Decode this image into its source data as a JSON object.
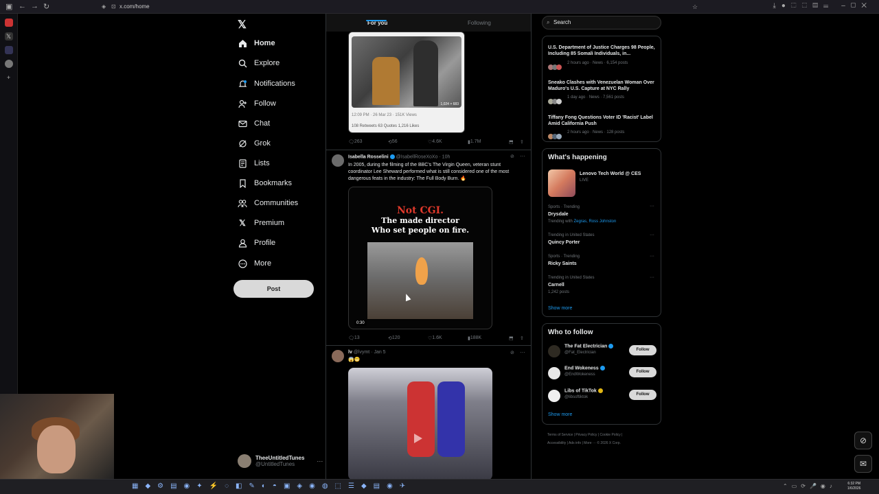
{
  "browser": {
    "url": "x.com/home"
  },
  "logo": "𝕏",
  "nav": [
    {
      "label": "Home",
      "icon": "home-icon"
    },
    {
      "label": "Explore",
      "icon": "search-icon"
    },
    {
      "label": "Notifications",
      "icon": "bell-icon"
    },
    {
      "label": "Follow",
      "icon": "person-add-icon"
    },
    {
      "label": "Chat",
      "icon": "mail-icon"
    },
    {
      "label": "Grok",
      "icon": "grok-icon"
    },
    {
      "label": "Lists",
      "icon": "list-icon"
    },
    {
      "label": "Bookmarks",
      "icon": "bookmark-icon"
    },
    {
      "label": "Communities",
      "icon": "people-icon"
    },
    {
      "label": "Premium",
      "icon": "x-icon"
    },
    {
      "label": "Profile",
      "icon": "person-icon"
    },
    {
      "label": "More",
      "icon": "more-circle-icon"
    }
  ],
  "post_button": "Post",
  "account": {
    "name": "TheeUntitledTunes",
    "handle": "@UntitledTunes"
  },
  "tabs": {
    "for_you": "For you",
    "following": "Following"
  },
  "tweet0": {
    "card_time": "12:09 PM · 26 Mar 23 · 151K Views",
    "card_stats": "108 Retweets  63 Quotes  1,216 Likes",
    "img_counter": "1,024 × 683",
    "replies": "263",
    "reposts": "56",
    "likes": "4.6K",
    "views": "1.7M"
  },
  "tweet1": {
    "name": "Isabella Rosselini",
    "handle": "@IsabellRoseXoXo · 10h",
    "text": "In 2005, during the filming of the BBC's The Virgin Queen, veteran stunt coordinator Lee Sheward performed what is still considered one of the most dangerous feats in the industry: The Full Body Burn. 🔥",
    "video_title": "Not CGI.",
    "video_sub1": "The made director",
    "video_sub2": "Who set people on fire.",
    "duration": "0:30",
    "replies": "13",
    "reposts": "120",
    "likes": "1.6K",
    "views": "188K"
  },
  "tweet2": {
    "name": "lv",
    "handle": "@lvymt · Jan 5",
    "text": "😱😬"
  },
  "search": {
    "placeholder": "Search"
  },
  "news": [
    {
      "title": "U.S. Department of Justice Charges 98 People, Including 85 Somali Individuals, in...",
      "meta": "2 hours ago · News · 6,154 posts"
    },
    {
      "title": "Sneako Clashes with Venezuelan Woman Over Maduro's U.S. Capture at NYC Rally",
      "meta": "1 day ago · News · 7,561 posts"
    },
    {
      "title": "Tiffany Fong Questions Voter ID 'Racist' Label Amid California Push",
      "meta": "2 hours ago · News · 128 posts"
    }
  ],
  "happening": {
    "title": "What's happening",
    "event": "Lenovo Tech World @ CES",
    "event_status": "LIVE",
    "trends": [
      {
        "context": "Sports · Trending",
        "name": "Drysdale",
        "sub": "Trending with ",
        "sub_links": "Zegras, Ross Johnston"
      },
      {
        "context": "Trending in United States",
        "name": "Quincy Porter",
        "sub": "",
        "sub_links": ""
      },
      {
        "context": "Sports · Trending",
        "name": "Ricky Saints",
        "sub": "",
        "sub_links": ""
      },
      {
        "context": "Trending in United States",
        "name": "Carnell",
        "sub": "1,242 posts",
        "sub_links": ""
      }
    ],
    "show_more": "Show more"
  },
  "who_to_follow": {
    "title": "Who to follow",
    "accounts": [
      {
        "name": "The Fat Electrician",
        "handle": "@Fat_Electrician",
        "button": "Follow"
      },
      {
        "name": "End Wokeness",
        "handle": "@EndWokeness",
        "button": "Follow"
      },
      {
        "name": "Libs of TikTok",
        "handle": "@libsoftiktok",
        "button": "Follow"
      }
    ],
    "show_more": "Show more"
  },
  "footer": {
    "line1": "Terms of Service  |  Privacy Policy  |  Cookie Policy  |",
    "line2": "Accessibility  |  Ads info  |  More ···  © 2026 X Corp."
  },
  "taskbar": {
    "time": "6:32 PM",
    "date": "1/6/2026"
  },
  "colors": {
    "accent": "#1d9bf0",
    "background": "#000000",
    "border": "#2f3336"
  }
}
